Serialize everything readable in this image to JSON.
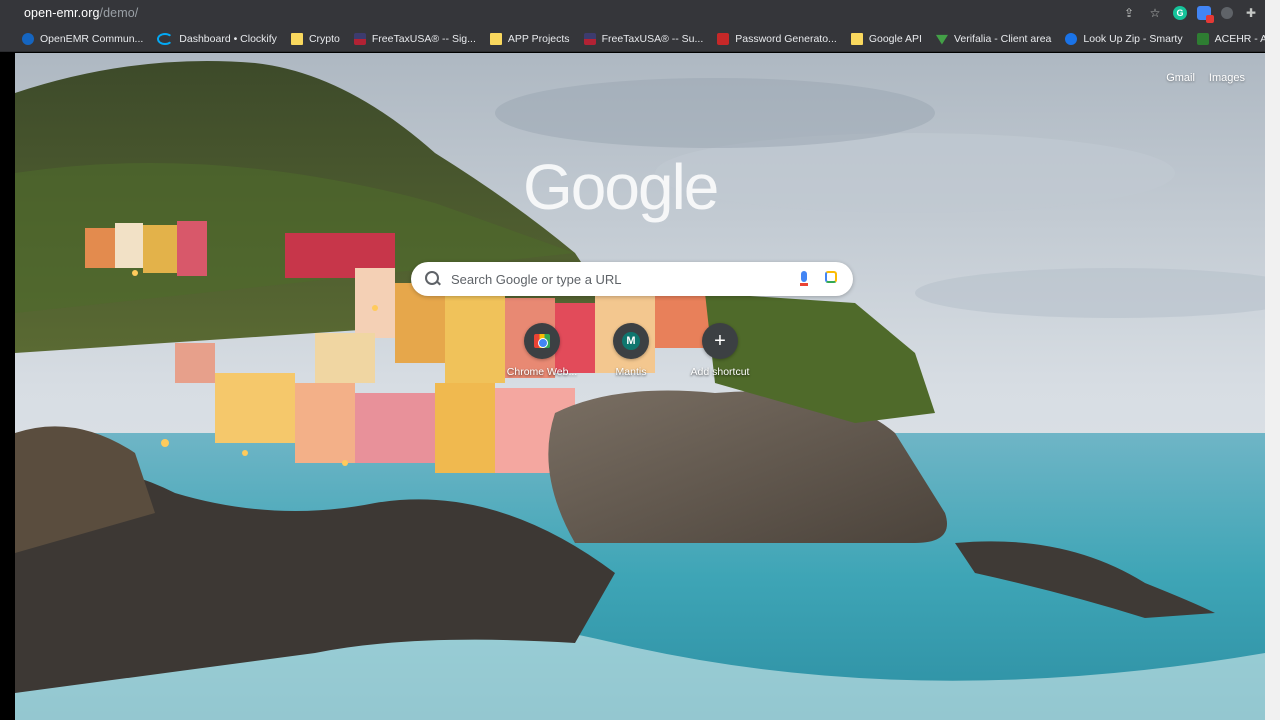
{
  "browser": {
    "url_host": "open-emr.org",
    "url_path": "/demo/",
    "icons": [
      "share-icon",
      "star-icon",
      "grammarly-extension-icon",
      "extension-badge-icon",
      "extension-gray-icon",
      "puzzle-icon"
    ]
  },
  "bookmarks": [
    {
      "label": "OpenEMR Commun...",
      "icon": "openemr-favicon"
    },
    {
      "label": "Dashboard • Clockify",
      "icon": "clockify-favicon"
    },
    {
      "label": "Crypto",
      "icon": "folder-icon"
    },
    {
      "label": "FreeTaxUSA® -- Sig...",
      "icon": "flag-favicon"
    },
    {
      "label": "APP Projects",
      "icon": "folder-icon"
    },
    {
      "label": "FreeTaxUSA® -- Su...",
      "icon": "flag-favicon"
    },
    {
      "label": "Password Generato...",
      "icon": "password-generator-favicon"
    },
    {
      "label": "Google API",
      "icon": "folder-icon"
    },
    {
      "label": "Verifalia - Client area",
      "icon": "verifalia-favicon"
    },
    {
      "label": "Look Up Zip - Smarty",
      "icon": "smarty-favicon"
    },
    {
      "label": "ACEHR - App Settin...",
      "icon": "acehr-favicon"
    }
  ],
  "ntp": {
    "links": {
      "gmail": "Gmail",
      "images": "Images"
    },
    "logo": "Google",
    "search_placeholder": "Search Google or type a URL",
    "shortcuts": [
      {
        "label": "Chrome Web...",
        "icon": "chrome-web-store-icon"
      },
      {
        "label": "Mantis",
        "letter": "M",
        "icon": "mantis-letter-icon"
      },
      {
        "label": "Add shortcut",
        "glyph": "+",
        "icon": "plus-icon"
      }
    ]
  },
  "colors": {
    "chrome_bar": "#35363a",
    "scrollbar": "#f1f1f1",
    "sky": "#c9d2da",
    "sea": "#3fa9b8"
  }
}
